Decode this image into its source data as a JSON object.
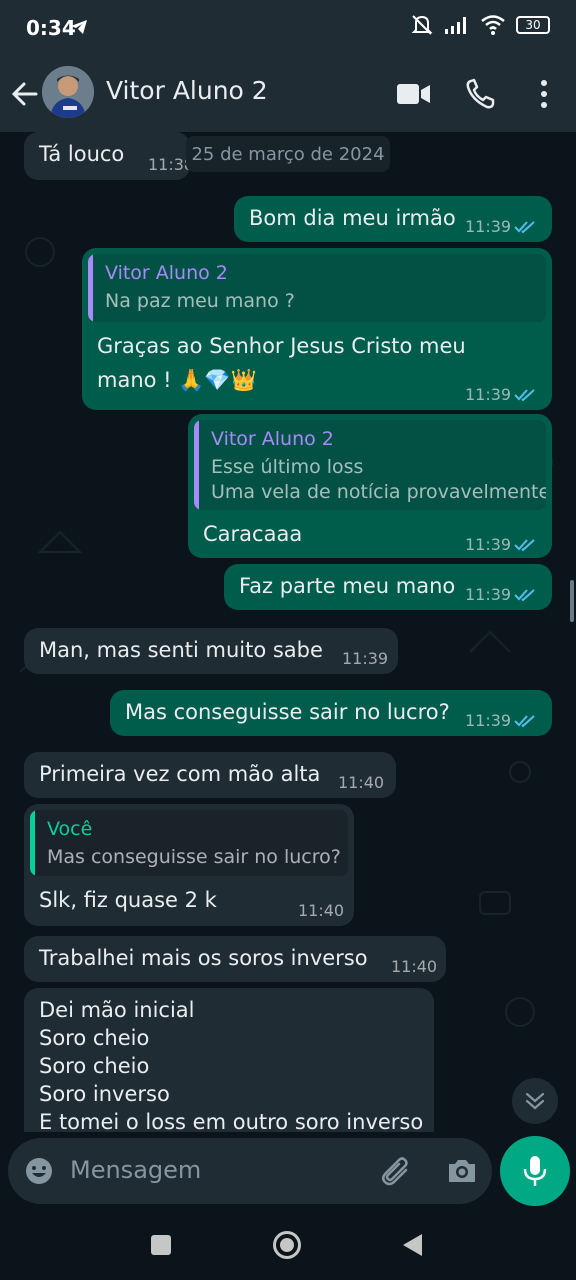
{
  "status_bar": {
    "time": "0:34",
    "battery": "30",
    "icons": [
      "telegram-icon",
      "mute-icon",
      "signal-icon",
      "wifi-icon",
      "battery-icon"
    ]
  },
  "header": {
    "contact_name": "Vitor Aluno 2",
    "icons": [
      "back-arrow-icon",
      "video-call-icon",
      "voice-call-icon",
      "more-options-icon"
    ]
  },
  "chat": {
    "date_chip": "25 de março de 2024",
    "messages": [
      {
        "dir": "in",
        "text": "Tá louco",
        "time": "11:38"
      },
      {
        "dir": "out",
        "text": "Bom dia meu irmão",
        "time": "11:39",
        "status": "read"
      },
      {
        "dir": "out",
        "quote_author": "Vitor Aluno 2",
        "quote_text": "Na paz meu mano ?",
        "text_lines": [
          "Graças ao Senhor Jesus Cristo meu",
          "mano ! 🙏💎👑"
        ],
        "time": "11:39",
        "status": "read"
      },
      {
        "dir": "out",
        "quote_author": "Vitor Aluno 2",
        "quote_lines": [
          "Esse último loss",
          "Uma vela de notícia provavelmente"
        ],
        "text": "Caracaaa",
        "time": "11:39",
        "status": "read"
      },
      {
        "dir": "out",
        "text": "Faz parte meu mano",
        "time": "11:39",
        "status": "read"
      },
      {
        "dir": "in",
        "text": "Man, mas senti muito sabe",
        "time": "11:39"
      },
      {
        "dir": "out",
        "text": "Mas conseguisse sair no lucro?",
        "time": "11:39",
        "status": "read"
      },
      {
        "dir": "in",
        "text": "Primeira vez com mão alta",
        "time": "11:40"
      },
      {
        "dir": "in",
        "quote_author": "Você",
        "quote_text": "Mas conseguisse sair no lucro?",
        "text": "Slk, fiz quase 2 k",
        "time": "11:40"
      },
      {
        "dir": "in",
        "text": "Trabalhei mais os soros inverso",
        "time": "11:40"
      },
      {
        "dir": "in",
        "text_lines": [
          "Dei mão inicial",
          "Soro cheio",
          "Soro cheio",
          "Soro inverso",
          "E tomei o loss em outro soro inverso"
        ]
      }
    ]
  },
  "composer": {
    "placeholder": "Mensagem",
    "icons": [
      "emoji-icon",
      "attach-icon",
      "camera-icon",
      "mic-icon"
    ]
  },
  "colors": {
    "incoming_bubble": "#202c33",
    "outgoing_bubble": "#005c4b",
    "read_ticks": "#53bdeb",
    "quote_author_contact": "#a78bfa",
    "quote_author_self": "#06cf9c",
    "accent": "#00a884"
  }
}
